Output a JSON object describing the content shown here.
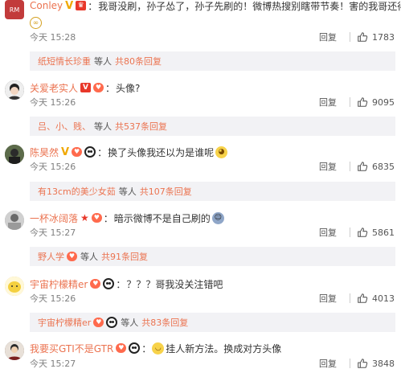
{
  "comments": [
    {
      "username": "Conley",
      "badges": [
        "v-gold",
        "fan"
      ],
      "content": "我哥没刷，孙子怂了，孙子先刷的！微博热搜别瞎带节奏！害的我哥还得换头像",
      "emoji": "glasses-emoji",
      "time": "今天 15:28",
      "reply_label": "回复",
      "likes": "1783",
      "avatar_text": "RM",
      "avatar_color": "#c23b3b",
      "sub": {
        "users": "纸短情长珍重",
        "deng": "等人",
        "total": "共80条回复"
      }
    },
    {
      "username": "关爱老实人",
      "badges": [
        "v-red",
        "fan"
      ],
      "content": "头像?",
      "time": "今天 15:26",
      "reply_label": "回复",
      "likes": "9095",
      "avatar_text": "",
      "avatar_color": "#3a3a3a",
      "sub": {
        "users": "吕、小、贱、",
        "deng": "等人",
        "total": "共537条回复"
      }
    },
    {
      "username": "陈昊然",
      "badges": [
        "v-gold",
        "fan",
        "panda"
      ],
      "content": "换了头像我还以为是谁呢",
      "emoji": "dog-emoji",
      "time": "今天 15:26",
      "reply_label": "回复",
      "likes": "6835",
      "avatar_text": "",
      "avatar_color": "#4a5a3a",
      "sub": {
        "users": "有13cm的美少女茹",
        "deng": "等人",
        "total": "共107条回复"
      }
    },
    {
      "username": "一杯冰阔落",
      "badges": [
        "star",
        "fan"
      ],
      "content": "暗示微博不是自己刷的",
      "emoji": "grin-emoji",
      "time": "今天 15:27",
      "reply_label": "回复",
      "likes": "5861",
      "avatar_text": "",
      "avatar_color": "#8a8a8a",
      "sub": {
        "users": "野人学",
        "badges": [
          "fan"
        ],
        "deng": "等人",
        "total": "共91条回复"
      }
    },
    {
      "username": "宇宙柠檬精er",
      "badges": [
        "fan",
        "panda"
      ],
      "content": "？？？哥我没关注错吧",
      "time": "今天 15:26",
      "reply_label": "回复",
      "likes": "4013",
      "avatar_text": "",
      "avatar_color": "#e0c060",
      "sub": {
        "users": "宇宙柠檬精er",
        "badges": [
          "fan",
          "panda"
        ],
        "deng": "等人",
        "total": "共83条回复"
      }
    },
    {
      "username": "我要买GTI不是GTR",
      "badges": [
        "fan",
        "panda"
      ],
      "content": "挂人新方法。换成对方头像",
      "emoji_before": "smile-emoji",
      "time": "今天 15:27",
      "reply_label": "回复",
      "likes": "3848",
      "avatar_text": "",
      "avatar_color": "#5a4a3a"
    }
  ],
  "colors": {
    "username": "#eb7350",
    "time": "#808080",
    "subreply_bg": "#f2f2f5"
  }
}
